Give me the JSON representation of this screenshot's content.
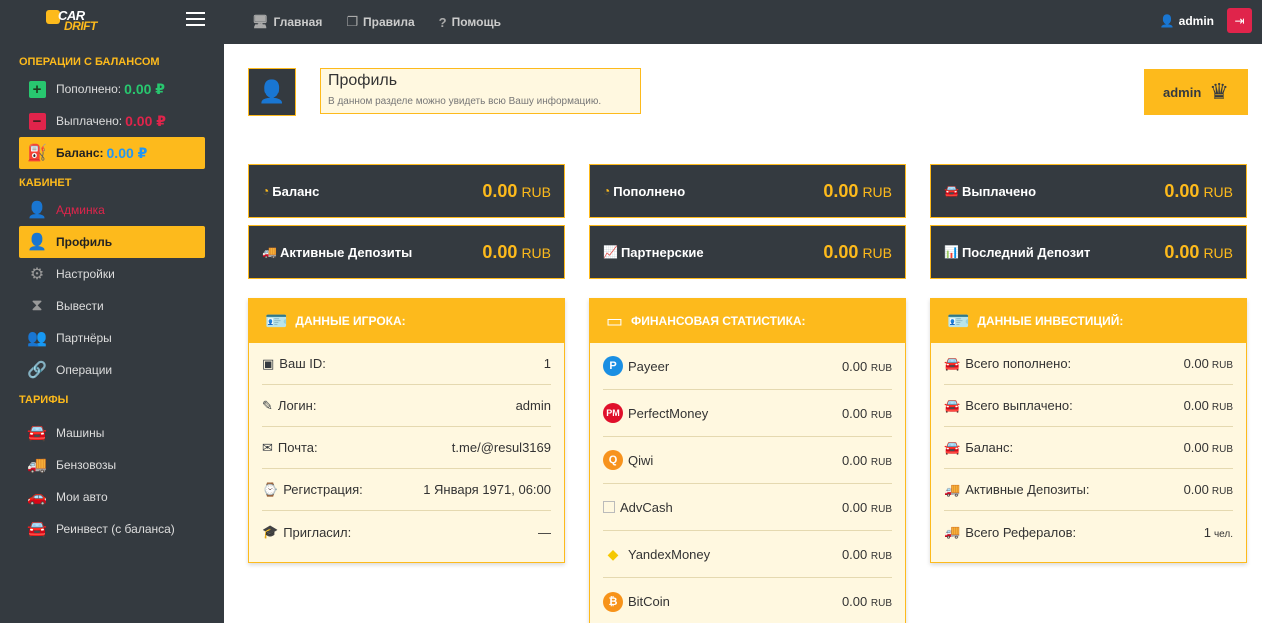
{
  "topbar": {
    "logo_car": "CAR",
    "logo_drift": "DRIFT",
    "nav": [
      {
        "label": "Главная",
        "icon": "monitor-icon"
      },
      {
        "label": "Правила",
        "icon": "copy-icon"
      },
      {
        "label": "Помощь",
        "icon": "question-icon"
      }
    ],
    "user": "admin"
  },
  "sidebar": {
    "balance_ops_title": "Операции с балансом",
    "deposited_label": "Пополнено:",
    "deposited_value": "0.00 ₽",
    "withdrawn_label": "Выплачено:",
    "withdrawn_value": "0.00 ₽",
    "balance_label": "Баланс:",
    "balance_value": "0.00 ₽",
    "cabinet_title": "Кабинет",
    "cabinet_items": [
      "Админка",
      "Профиль",
      "Настройки",
      "Вывести",
      "Партнёры",
      "Операции"
    ],
    "tariffs_title": "Тарифы",
    "tariff_items": [
      "Машины",
      "Бензовозы",
      "Мои авто",
      "Реинвест (с баланса)"
    ]
  },
  "header": {
    "title": "Профиль",
    "subtitle": "В данном разделе можно увидеть всю Вашу информацию.",
    "admin_badge": "admin"
  },
  "stats": [
    {
      "label": "Баланс",
      "value": "0.00",
      "currency": "RUB"
    },
    {
      "label": "Пополнено",
      "value": "0.00",
      "currency": "RUB"
    },
    {
      "label": "Выплачено",
      "value": "0.00",
      "currency": "RUB"
    },
    {
      "label": "Активные Депозиты",
      "value": "0.00",
      "currency": "RUB"
    },
    {
      "label": "Партнерские",
      "value": "0.00",
      "currency": "RUB"
    },
    {
      "label": "Последний Депозит",
      "value": "0.00",
      "currency": "RUB"
    }
  ],
  "player_panel": {
    "title": "Данные игрока:",
    "rows": [
      {
        "label": "Ваш ID:",
        "value": "1"
      },
      {
        "label": "Логин:",
        "value": "admin"
      },
      {
        "label": "Почта:",
        "value": "t.me/@resul3169"
      },
      {
        "label": "Регистрация:",
        "value": "1 Января 1971, 06:00"
      },
      {
        "label": "Пригласил:",
        "value": "—"
      }
    ]
  },
  "finance_panel": {
    "title": "Финансовая статистика:",
    "rows": [
      {
        "label": "Payeer",
        "value": "0.00",
        "currency": "RUB"
      },
      {
        "label": "PerfectMoney",
        "value": "0.00",
        "currency": "RUB"
      },
      {
        "label": "Qiwi",
        "value": "0.00",
        "currency": "RUB"
      },
      {
        "label": "AdvCash",
        "value": "0.00",
        "currency": "RUB"
      },
      {
        "label": "YandexMoney",
        "value": "0.00",
        "currency": "RUB"
      },
      {
        "label": "BitCoin",
        "value": "0.00",
        "currency": "RUB"
      }
    ]
  },
  "invest_panel": {
    "title": "Данные инвестиций:",
    "rows": [
      {
        "label": "Всего пополнено:",
        "value": "0.00",
        "currency": "RUB"
      },
      {
        "label": "Всего выплачено:",
        "value": "0.00",
        "currency": "RUB"
      },
      {
        "label": "Баланс:",
        "value": "0.00",
        "currency": "RUB"
      },
      {
        "label": "Активные Депозиты:",
        "value": "0.00",
        "currency": "RUB"
      },
      {
        "label": "Всего Рефералов:",
        "value": "1",
        "currency": "чел."
      }
    ]
  },
  "colors": {
    "accent": "#fdba1c",
    "dark": "#343a40",
    "green": "#28c76f",
    "red": "#e0244b",
    "blue": "#2196f3"
  }
}
